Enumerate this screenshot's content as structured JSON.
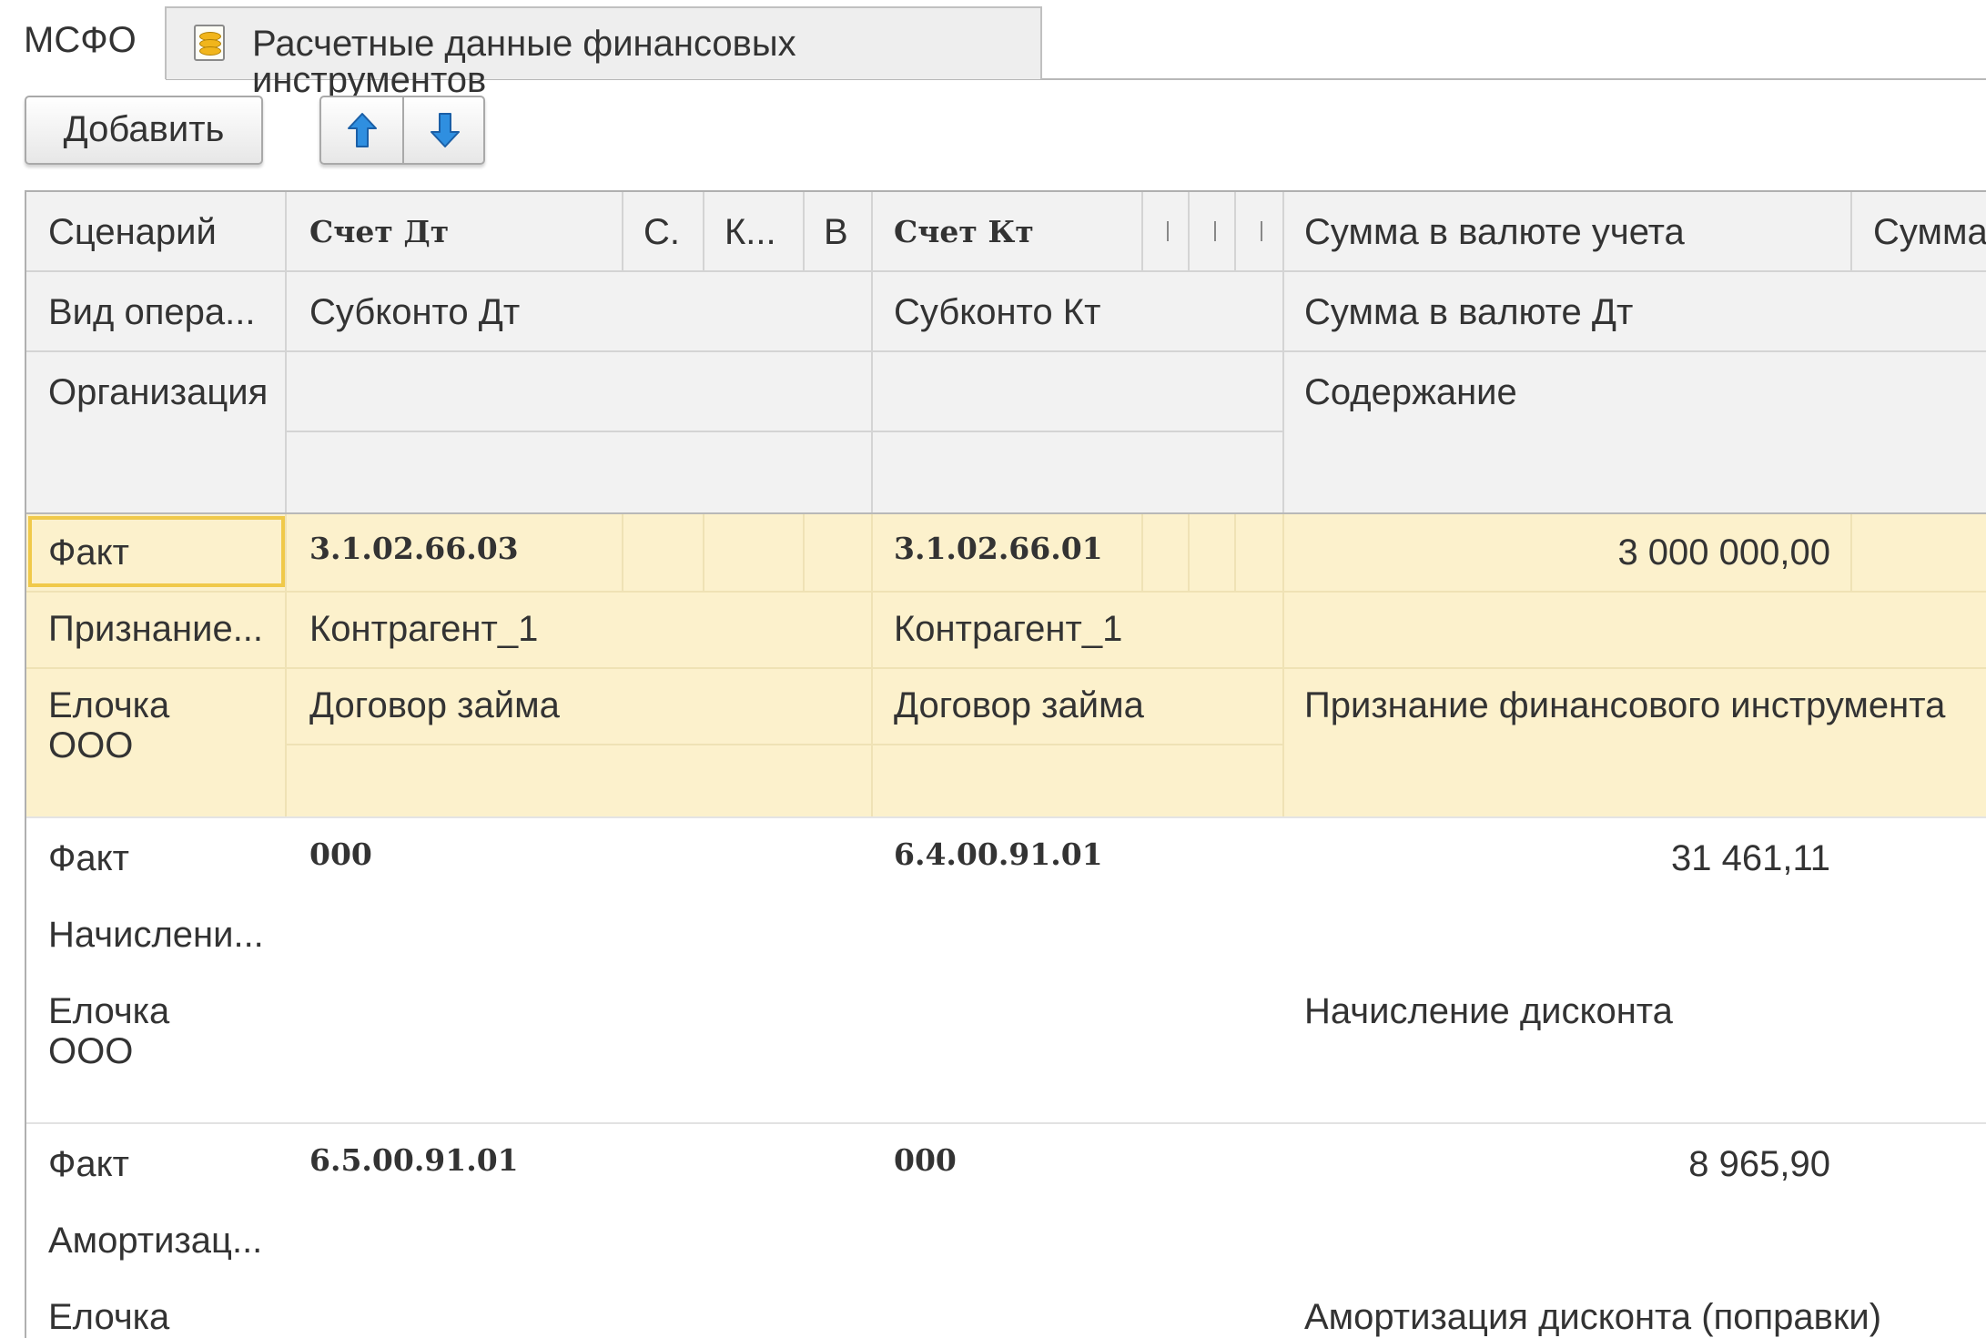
{
  "tabs": {
    "active": "МСФО",
    "document": "Расчетные данные финансовых инструментов"
  },
  "toolbar": {
    "add_label": "Добавить",
    "move_up_icon": "arrow-up-icon",
    "move_down_icon": "arrow-down-icon"
  },
  "colors": {
    "selected_row": "#fcf1cc",
    "focus_border": "#f0c94a",
    "header_bg": "#f2f2f2",
    "arrow_blue": "#2f8fe0"
  },
  "columns": {
    "scenario": "Сценарий",
    "account_dt": "Счет Дт",
    "col_s": "С.",
    "col_k": "К...",
    "col_v": "В",
    "account_kt": "Счет Кт",
    "amount_accounting": "Сумма в валюте учета",
    "amount_more": "Сумма",
    "operation_type": "Вид опера...",
    "subconto_dt": "Субконто Дт",
    "subconto_kt": "Субконто Кт",
    "amount_currency_dt": "Сумма в валюте Дт",
    "organization": "Организация",
    "content": "Содержание"
  },
  "rows": [
    {
      "scenario": "Факт",
      "account_dt": "3.1.02.66.03",
      "account_kt": "3.1.02.66.01",
      "amount": "3 000 000,00",
      "operation": "Признание...",
      "subconto_dt_1": "Контрагент_1",
      "subconto_kt_1": "Контрагент_1",
      "org_line1": "Елочка",
      "org_line2": "ООО",
      "subconto_dt_2": "Договор займа",
      "subconto_kt_2": "Договор займа",
      "content": "Признание финансового инструмента"
    },
    {
      "scenario": "Факт",
      "account_dt": "000",
      "account_kt": "6.4.00.91.01",
      "amount": "31 461,11",
      "operation": "Начислени...",
      "org_line1": "Елочка",
      "org_line2": "ООО",
      "content": "Начисление дисконта"
    },
    {
      "scenario": "Факт",
      "account_dt": "6.5.00.91.01",
      "account_kt": "000",
      "amount": "8 965,90",
      "operation": "Амортизац...",
      "org_line1": "Елочка",
      "content": "Амортизация дисконта (поправки)"
    }
  ]
}
